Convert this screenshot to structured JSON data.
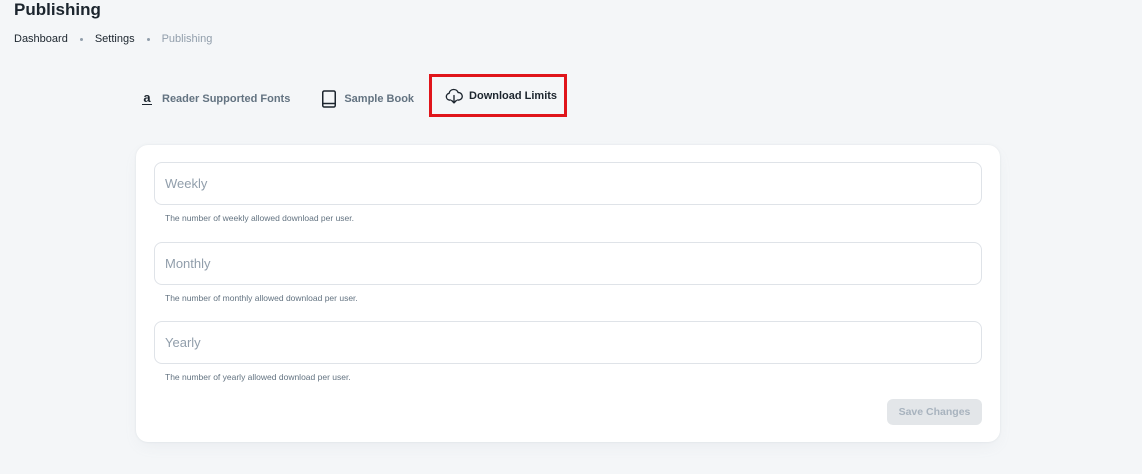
{
  "page": {
    "title": "Publishing"
  },
  "breadcrumb": {
    "items": [
      "Dashboard",
      "Settings",
      "Publishing"
    ]
  },
  "tabs": [
    {
      "label": "Reader Supported Fonts",
      "icon": "font-a-icon",
      "icon_glyph": "a"
    },
    {
      "label": "Sample Book",
      "icon": "book-icon"
    },
    {
      "label": "Download Limits",
      "icon": "cloud-download-icon",
      "active": true
    }
  ],
  "form": {
    "weekly": {
      "placeholder": "Weekly",
      "value": "",
      "helper": "The number of weekly allowed download per user."
    },
    "monthly": {
      "placeholder": "Monthly",
      "value": "",
      "helper": "The number of monthly allowed download per user."
    },
    "yearly": {
      "placeholder": "Yearly",
      "value": "",
      "helper": "The number of yearly allowed download per user."
    },
    "save_label": "Save Changes",
    "save_disabled": true
  },
  "colors": {
    "highlight_border": "#e0151b",
    "text_primary": "#1c252e",
    "text_secondary": "#637381",
    "text_disabled": "#919eab",
    "background": "#f4f6f8"
  }
}
